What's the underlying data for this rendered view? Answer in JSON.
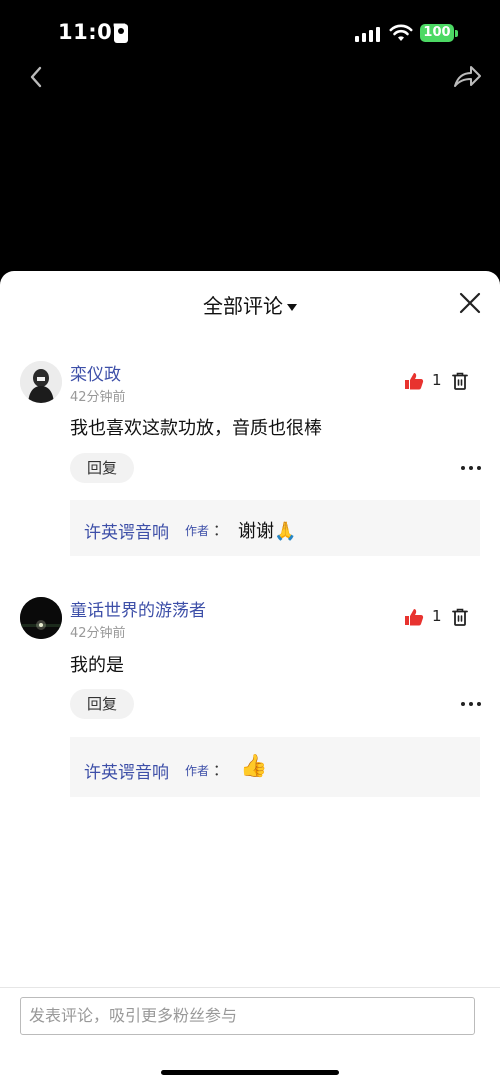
{
  "status": {
    "time": "11:07",
    "battery": "100"
  },
  "sheet": {
    "title": "全部评论"
  },
  "comments": [
    {
      "author": "栾仪政",
      "time": "42分钟前",
      "content": "我也喜欢这款功放，音质也很棒",
      "likes": "1",
      "reply_label": "回复",
      "reply": {
        "author": "许英谔音响",
        "tag": "作者",
        "colon": "：",
        "text": "谢谢🙏"
      }
    },
    {
      "author": "童话世界的游荡者",
      "time": "42分钟前",
      "content": "我的是",
      "likes": "1",
      "reply_label": "回复",
      "reply": {
        "author": "许英谔音响",
        "tag": "作者",
        "colon": "：",
        "text": "👍"
      }
    }
  ],
  "input": {
    "placeholder": "发表评论，吸引更多粉丝参与"
  },
  "colors": {
    "link": "#3d4fa8",
    "like": "#e8332f",
    "battery": "#4cd964"
  }
}
